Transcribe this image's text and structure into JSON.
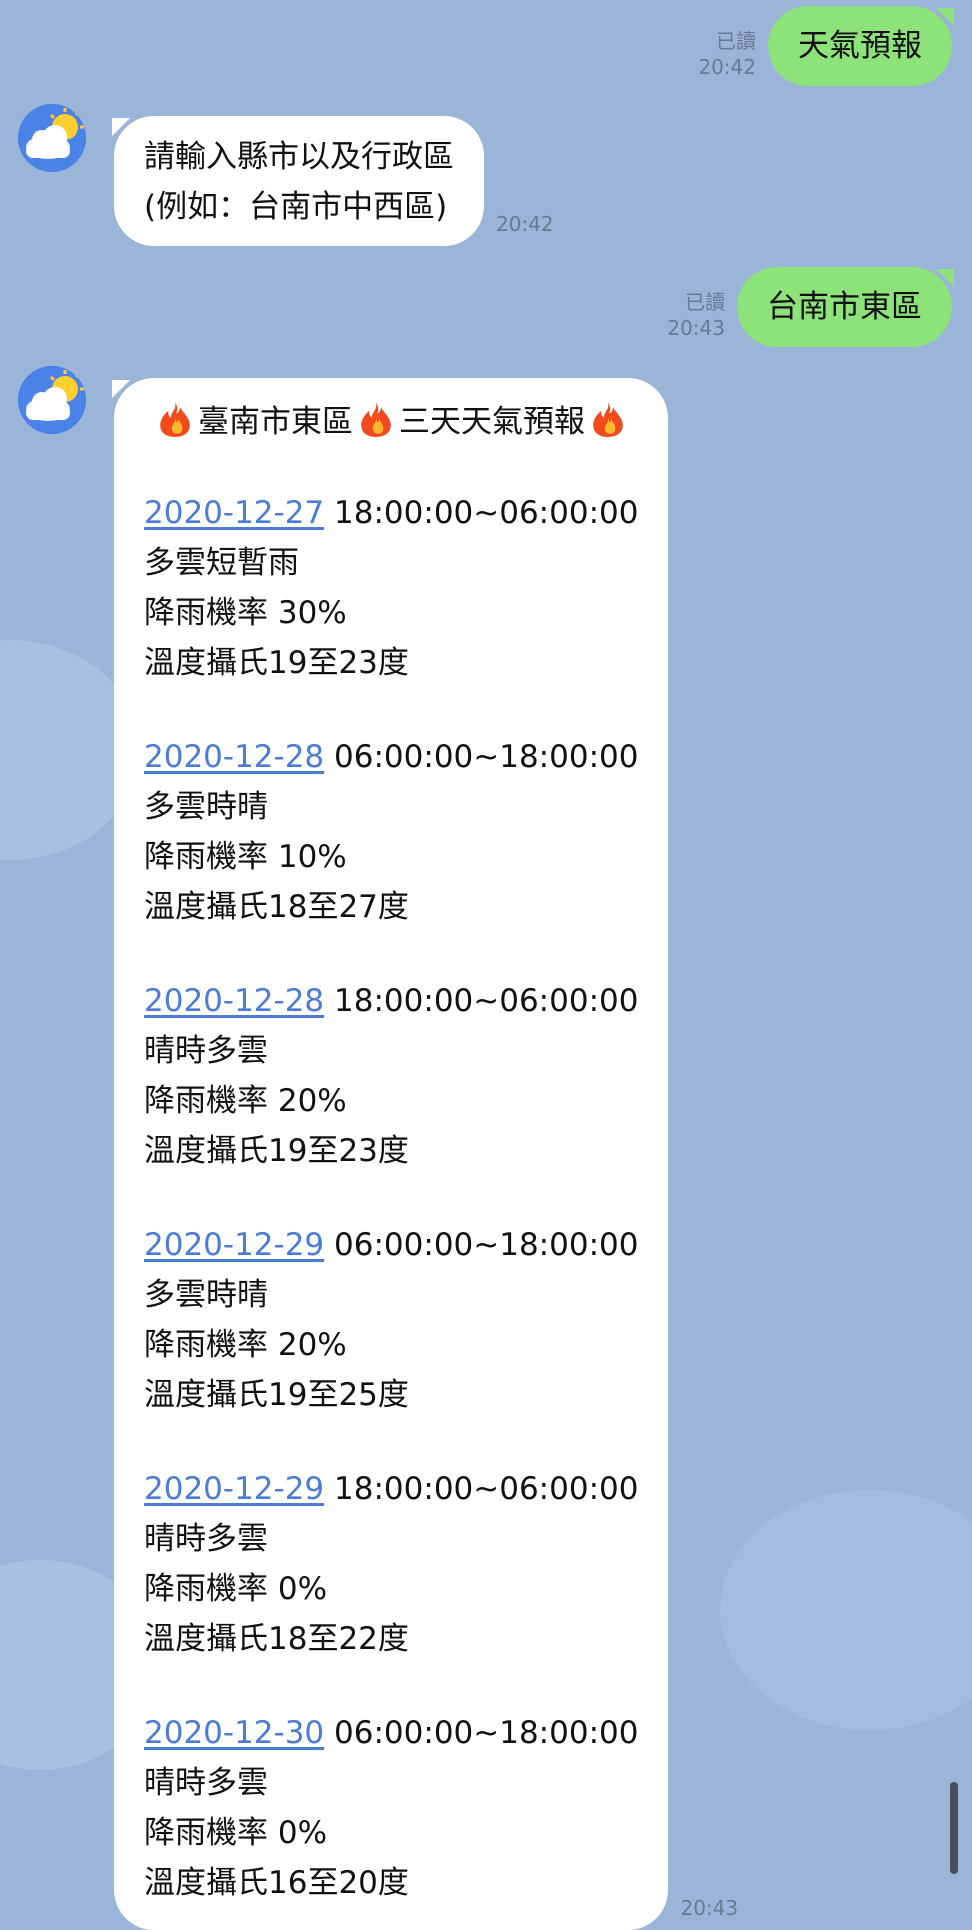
{
  "messages": [
    {
      "read": "已讀",
      "time": "20:42",
      "text": "天氣預報"
    },
    {
      "lines": [
        "請輸入縣市以及行政區",
        "(例如：台南市中西區)"
      ],
      "time": "20:42"
    },
    {
      "read": "已讀",
      "time": "20:43",
      "text": "台南市東區"
    }
  ],
  "forecast": {
    "time": "20:43",
    "title_parts": [
      "臺南市東區",
      "三天天氣預報"
    ],
    "entries": [
      {
        "date": "2020-12-27",
        "range": "18:00:00~06:00:00",
        "weather": "多雲短暫雨",
        "rain": "降雨機率 30%",
        "temp": "溫度攝氏19至23度"
      },
      {
        "date": "2020-12-28",
        "range": "06:00:00~18:00:00",
        "weather": "多雲時晴",
        "rain": "降雨機率 10%",
        "temp": "溫度攝氏18至27度"
      },
      {
        "date": "2020-12-28",
        "range": "18:00:00~06:00:00",
        "weather": "晴時多雲",
        "rain": "降雨機率 20%",
        "temp": "溫度攝氏19至23度"
      },
      {
        "date": "2020-12-29",
        "range": "06:00:00~18:00:00",
        "weather": "多雲時晴",
        "rain": "降雨機率 20%",
        "temp": "溫度攝氏19至25度"
      },
      {
        "date": "2020-12-29",
        "range": "18:00:00~06:00:00",
        "weather": "晴時多雲",
        "rain": "降雨機率 0%",
        "temp": "溫度攝氏18至22度"
      },
      {
        "date": "2020-12-30",
        "range": "06:00:00~18:00:00",
        "weather": "晴時多雲",
        "rain": "降雨機率 0%",
        "temp": "溫度攝氏16至20度"
      }
    ]
  },
  "icons": {
    "avatar": "weather-bot-avatar-icon",
    "fire": "fire-icon"
  },
  "colors": {
    "background": "#9bb5d8",
    "outgoing_bubble": "#8de27a",
    "incoming_bubble": "#ffffff",
    "link": "#4c7bd9"
  }
}
